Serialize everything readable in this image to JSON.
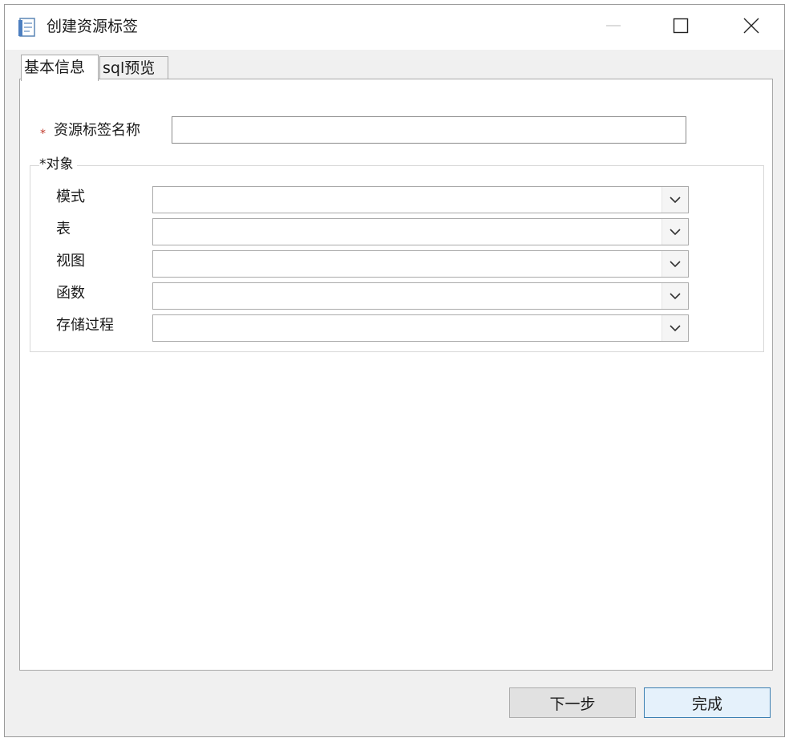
{
  "window": {
    "title": "创建资源标签"
  },
  "tabs": [
    {
      "label": "基本信息",
      "active": true
    },
    {
      "label": "sql预览",
      "active": false
    }
  ],
  "form": {
    "required_mark": "*",
    "name_label": "资源标签名称",
    "name_value": "",
    "object_group": {
      "legend": "*对象",
      "rows": [
        {
          "label": "模式",
          "value": ""
        },
        {
          "label": "表",
          "value": ""
        },
        {
          "label": "视图",
          "value": ""
        },
        {
          "label": "函数",
          "value": ""
        },
        {
          "label": "存储过程",
          "value": ""
        }
      ]
    }
  },
  "buttons": {
    "next": "下一步",
    "finish": "完成"
  },
  "icons": {
    "app": "document-tag-icon",
    "minimize": "minimize-icon",
    "maximize": "maximize-icon",
    "close": "close-icon",
    "dropdown": "chevron-down-icon"
  },
  "colors": {
    "required": "#c0392b",
    "primary_border": "#3c7fb1"
  }
}
